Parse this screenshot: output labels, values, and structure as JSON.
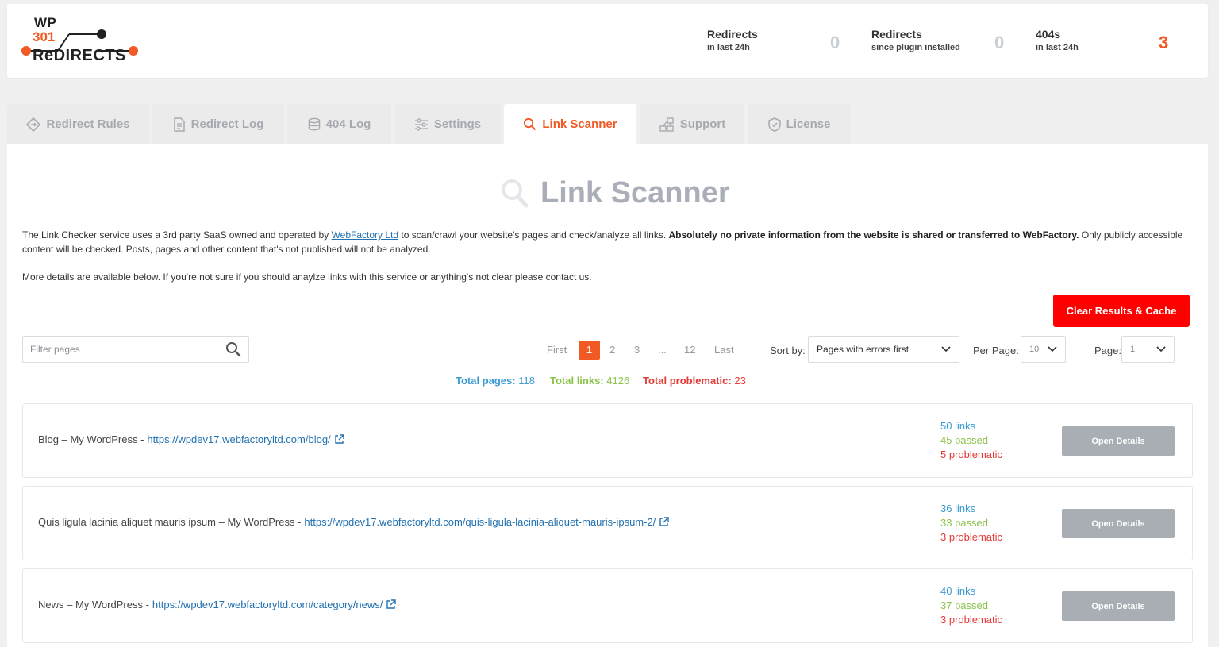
{
  "logo": {
    "line1": "WP",
    "line2": "301",
    "line3": "ReDIRECTS"
  },
  "stats": [
    {
      "title": "Redirects",
      "subtitle": "in last 24h",
      "value": "0"
    },
    {
      "title": "Redirects",
      "subtitle": "since plugin installed",
      "value": "0"
    },
    {
      "title": "404s",
      "subtitle": "in last 24h",
      "value": "3"
    }
  ],
  "tabs": [
    {
      "label": "Redirect Rules",
      "icon": "diamond-arrow-icon"
    },
    {
      "label": "Redirect Log",
      "icon": "document-icon"
    },
    {
      "label": "404 Log",
      "icon": "database-icon"
    },
    {
      "label": "Settings",
      "icon": "sliders-icon"
    },
    {
      "label": "Link Scanner",
      "icon": "search-icon",
      "active": true
    },
    {
      "label": "Support",
      "icon": "support-icon"
    },
    {
      "label": "License",
      "icon": "shield-check-icon"
    }
  ],
  "main": {
    "title": "Link Scanner",
    "intro": {
      "part1": "The Link Checker service uses a 3rd party SaaS owned and operated by ",
      "link": "WebFactory Ltd",
      "part2": " to scan/crawl your website's pages and check/analyze all links. ",
      "bold": "Absolutely no private information from the website is shared or transferred to WebFactory.",
      "part3": " Only publicly accessible content will be checked. Posts, pages and other content that's not published will not be analyzed."
    },
    "intro2": "More details are available below. If you're not sure if you should anaylze links with this service or anything's not clear please contact us.",
    "clear_button": "Clear Results & Cache",
    "filter_placeholder": "Filter pages",
    "pagination": {
      "first": "First",
      "current": "1",
      "p2": "2",
      "p3": "3",
      "ellipsis": "...",
      "p12": "12",
      "last": "Last"
    },
    "sort_label": "Sort by:",
    "sort_value": "Pages with errors first",
    "per_page_label": "Per Page:",
    "per_page_value": "10",
    "page_label": "Page:",
    "page_value": "1",
    "totals": {
      "pages_label": "Total pages:",
      "pages": "118",
      "links_label": "Total links:",
      "links": "4126",
      "problematic_label": "Total problematic:",
      "problematic": "23"
    },
    "rows": [
      {
        "title": "Blog – My WordPress - ",
        "url": "https://wpdev17.webfactoryltd.com/blog/",
        "links": "50 links",
        "passed": "45 passed",
        "problematic": "5 problematic",
        "button": "Open Details"
      },
      {
        "title": "Quis ligula lacinia aliquet mauris ipsum – My WordPress - ",
        "url": "https://wpdev17.webfactoryltd.com/quis-ligula-lacinia-aliquet-mauris-ipsum-2/",
        "links": "36 links",
        "passed": "33 passed",
        "problematic": "3 problematic",
        "button": "Open Details"
      },
      {
        "title": "News – My WordPress - ",
        "url": "https://wpdev17.webfactoryltd.com/category/news/",
        "links": "40 links",
        "passed": "37 passed",
        "problematic": "3 problematic",
        "button": "Open Details"
      }
    ]
  },
  "colors": {
    "accent": "#f15a24",
    "clear_button": "#ff0000",
    "links": "#3b9bd3",
    "passed": "#8bc34a",
    "problematic": "#e53935",
    "link": "#2271b1"
  }
}
